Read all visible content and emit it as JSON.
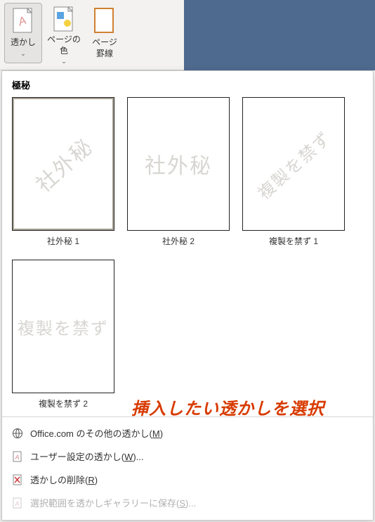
{
  "ribbon": {
    "watermark": {
      "label": "透かし",
      "chev": "⌄"
    },
    "pagecolor": {
      "label": "ページの\n色",
      "chev": "⌄"
    },
    "pageborder": {
      "label": "ページ\n罫線"
    }
  },
  "panel": {
    "section_title": "極秘",
    "thumbs": [
      {
        "wm": "社外秘",
        "diagonal": true,
        "label": "社外秘 1"
      },
      {
        "wm": "社外秘",
        "diagonal": false,
        "label": "社外秘 2"
      },
      {
        "wm": "複製を禁ず",
        "diagonal": true,
        "label": "複製を禁ず 1"
      },
      {
        "wm": "複製を禁ず",
        "diagonal": false,
        "label": "複製を禁ず 2"
      }
    ],
    "annotation": "挿入したい透かしを選択"
  },
  "menu": {
    "office": {
      "label": "Office.com のその他の透かし(",
      "accel": "M",
      "tail": ")"
    },
    "custom": {
      "label": "ユーザー設定の透かし(",
      "accel": "W",
      "tail": ")..."
    },
    "remove": {
      "label": "透かしの削除(",
      "accel": "R",
      "tail": ")"
    },
    "save": {
      "label": "選択範囲を透かしギャラリーに保存(",
      "accel": "S",
      "tail": ")..."
    }
  }
}
